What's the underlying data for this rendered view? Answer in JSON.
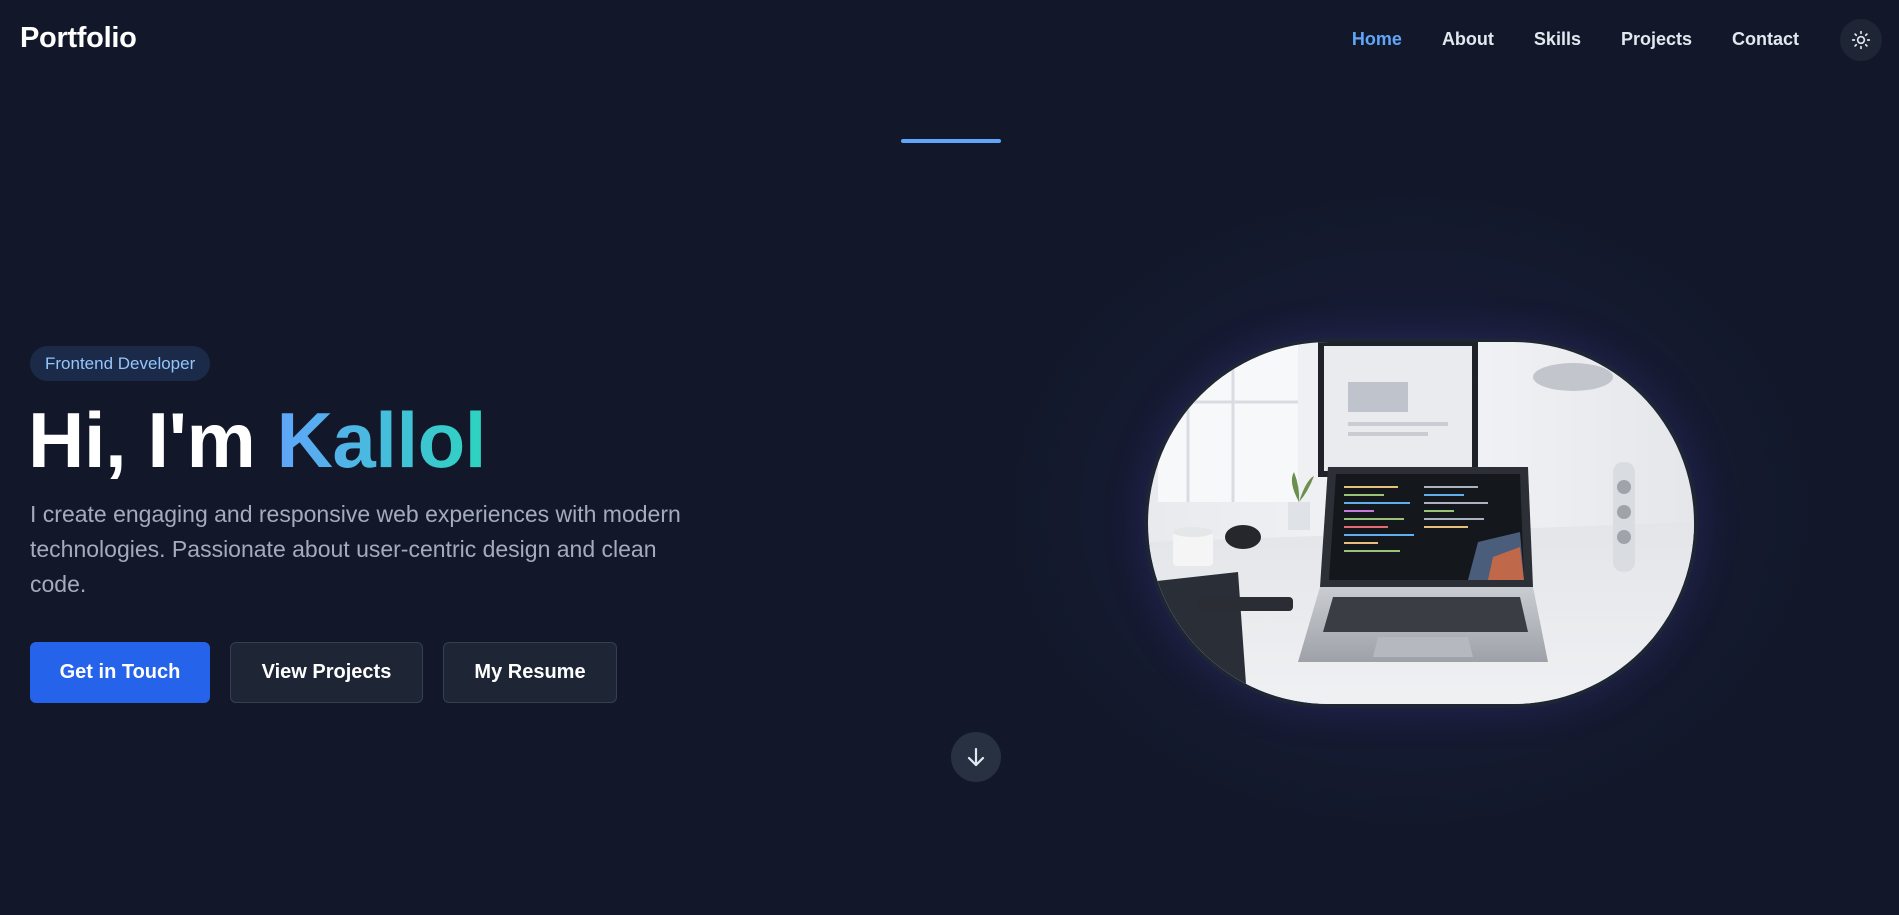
{
  "header": {
    "logo": "Portfolio",
    "nav": [
      "Home",
      "About",
      "Skills",
      "Projects",
      "Contact"
    ],
    "active_nav": "Home",
    "theme_toggle_icon": "sun-icon"
  },
  "hero": {
    "badge": "Frontend Developer",
    "title_prefix": "Hi, I'm ",
    "title_name": "Kallol",
    "description": "I create engaging and responsive web experiences with modern technologies. Passionate about user-centric design and clean code.",
    "buttons": {
      "primary": "Get in Touch",
      "projects": "View Projects",
      "resume": "My Resume"
    },
    "scroll_icon": "arrow-down-icon"
  },
  "colors": {
    "background": "#121829",
    "accent": "#60a5fa",
    "primary_button": "#2563eb",
    "gradient_end": "#2dd4bf"
  }
}
